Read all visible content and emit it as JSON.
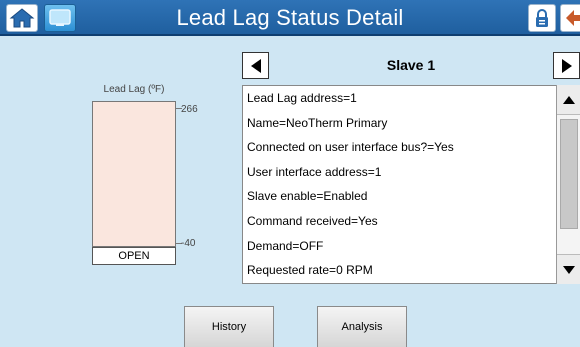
{
  "header": {
    "title": "Lead Lag Status Detail",
    "background": "#2a6cb0",
    "home_icon": "home-icon",
    "screen_icon": "screen-icon",
    "lock_icon": "lock-icon",
    "back_icon": "back-arrow-icon"
  },
  "gauge": {
    "label": "Lead Lag (ºF)",
    "max": "266",
    "min": "-40",
    "fill_fraction": 0,
    "status": "OPEN"
  },
  "slave": {
    "title": "Slave 1",
    "prev_icon": "arrow-left-icon",
    "next_icon": "arrow-right-icon"
  },
  "details": [
    "Lead Lag address=1",
    "Name=NeoTherm Primary",
    "Connected on user interface bus?=Yes",
    "User interface address=1",
    "Slave enable=Enabled",
    "Command received=Yes",
    "Demand=OFF",
    "Requested rate=0 RPM"
  ],
  "scrollbar": {
    "up_icon": "scroll-up-icon",
    "down_icon": "scroll-down-icon"
  },
  "buttons": {
    "history": "History",
    "analysis": "Analysis"
  }
}
